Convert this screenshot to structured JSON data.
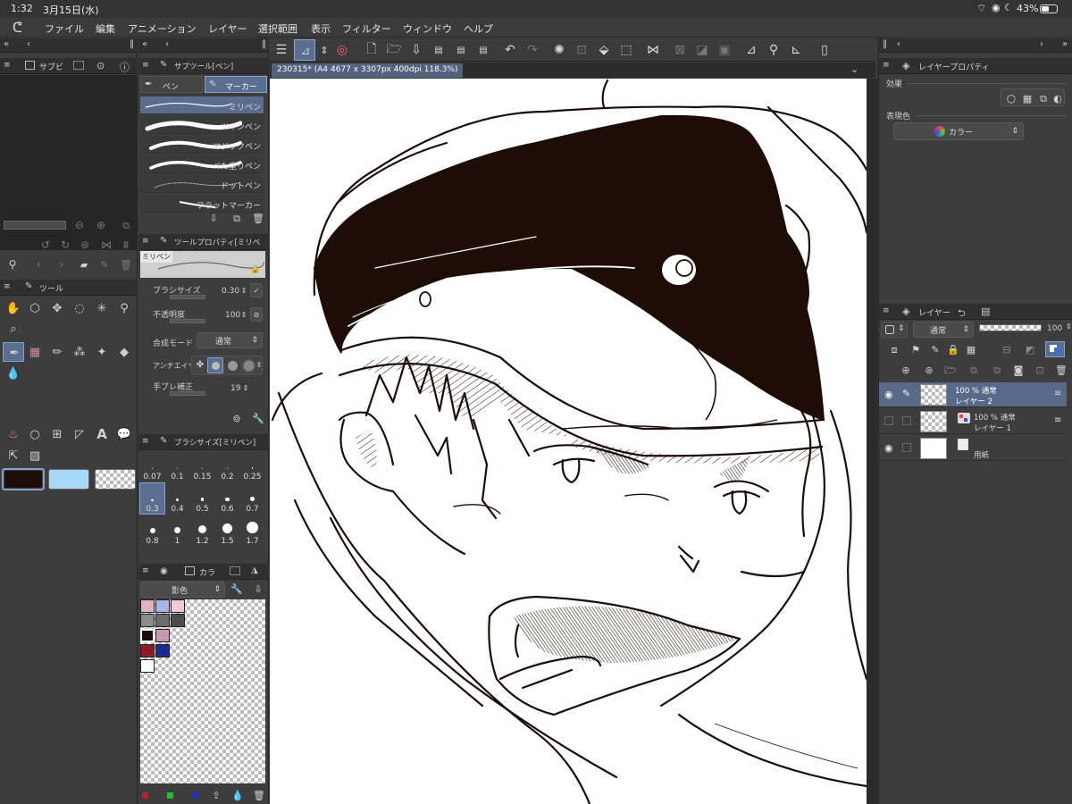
{
  "status": {
    "time": "1:32",
    "date": "3月15日(水)",
    "battery": "43%"
  },
  "menu": [
    "ファイル",
    "編集",
    "アニメーション",
    "レイヤー",
    "選択範囲",
    "表示",
    "フィルター",
    "ウィンドウ",
    "ヘルプ"
  ],
  "document_tab": "230315* (A4 4677 x 3307px 400dpi 118.3%)",
  "left_panel": {
    "tab_sub": "サブビ"
  },
  "subtool": {
    "header": "サブツール[ペン]",
    "tabs": [
      "ペン",
      "マーカー"
    ],
    "items": [
      "ミリペン",
      "ツインペン",
      "マジックペン",
      "べた塗りペン",
      "ドットペン",
      "フラットマーカー"
    ]
  },
  "tool_property": {
    "header": "ツールプロパティ[ミリペ",
    "preview_label": "ミリペン",
    "brush_size_label": "ブラシサイズ",
    "brush_size_value": "0.30",
    "opacity_label": "不透明度",
    "opacity_value": "100",
    "blend_label": "合成モード",
    "blend_value": "通常",
    "antialias_label": "アンチエイリ",
    "stabilization_label": "手ブレ補正",
    "stabilization_value": "19"
  },
  "brush_size": {
    "header": "ブラシサイズ[ミリペン]",
    "values": [
      "0.07",
      "0.1",
      "0.15",
      "0.2",
      "0.25",
      "0.3",
      "0.4",
      "0.5",
      "0.6",
      "0.7",
      "0.8",
      "1",
      "1.2",
      "1.5",
      "1.7"
    ],
    "selected": "0.3"
  },
  "tool_panel": {
    "header": "ツール"
  },
  "color_set": {
    "header_tab": "カラ",
    "dropdown": "影色"
  },
  "layer_property": {
    "header": "レイヤープロパティ",
    "effect_label": "効果",
    "expression_label": "表現色",
    "expression_value": "カラー"
  },
  "layer_panel": {
    "header": "レイヤー",
    "blend_mode": "通常",
    "opacity": "100",
    "layers": [
      {
        "opacity_mode": "100 % 通常",
        "name": "レイヤー 2",
        "selected": true,
        "visible": true
      },
      {
        "opacity_mode": "100 % 通常",
        "name": "レイヤー 1",
        "selected": false,
        "visible": false
      },
      {
        "opacity_mode": "",
        "name": "用紙",
        "selected": false,
        "visible": true
      }
    ]
  },
  "colors": {
    "main": "#1d0d08",
    "sub": "#a8d8f8",
    "ink": "#1e0c06"
  }
}
